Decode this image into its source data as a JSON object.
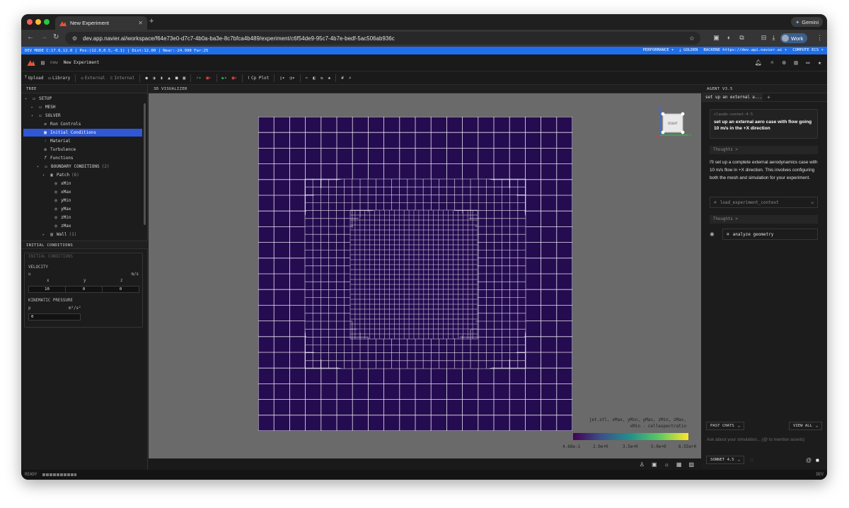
{
  "browser": {
    "tab_title": "New Experiment",
    "new_tab": "+",
    "gemini_label": "Gemini",
    "url": "dev.app.navier.ai/workspace/f64e73e0-d7c7-4b0a-ba3e-8c7bfca4b489/experiment/c6f54de9-95c7-4b7e-bedf-5ac506ab936c",
    "profile_label": "Work"
  },
  "devbar": {
    "left": "DEV MODE  C:17.6,12.0 | Pos:(12.0,0.5,-0.1) | Dist:12.00 | Near:-24.990 Far:25",
    "performance": "PERFORMANCE ▾",
    "golden": "⤓ GOLDEN",
    "backend": "BACKEND https://dev.api.navier.ai ▾",
    "compute": "COMPUTE ECS ▾"
  },
  "header": {
    "crumb_root": "new",
    "crumb_current": "New Experiment"
  },
  "toolbar": {
    "upload": "Upload",
    "library": "Library",
    "external": "External",
    "internal": "Internal",
    "cp_plot": "Cp Plot"
  },
  "tree": {
    "title": "TREE",
    "rows": [
      {
        "label": "SETUP",
        "count": ""
      },
      {
        "label": "MESH",
        "count": ""
      },
      {
        "label": "SOLVER",
        "count": ""
      },
      {
        "label": "Run Controls",
        "count": ""
      },
      {
        "label": "Initial Conditions",
        "count": ""
      },
      {
        "label": "Material",
        "count": ""
      },
      {
        "label": "Turbulence",
        "count": ""
      },
      {
        "label": "Functions",
        "count": ""
      },
      {
        "label": "BOUNDARY CONDITIONS",
        "count": "(2)"
      },
      {
        "label": "Patch",
        "count": "(6)"
      },
      {
        "label": "xMin",
        "count": ""
      },
      {
        "label": "xMax",
        "count": ""
      },
      {
        "label": "yMin",
        "count": ""
      },
      {
        "label": "yMax",
        "count": ""
      },
      {
        "label": "zMin",
        "count": ""
      },
      {
        "label": "zMax",
        "count": ""
      },
      {
        "label": "Wall",
        "count": "(1)"
      }
    ]
  },
  "initial_conditions": {
    "title": "INITIAL CONDITIONS",
    "subtitle": "INITIAL CONDITIONS",
    "velocity_label": "VELOCITY",
    "u_label": "u",
    "u_unit": "m/s",
    "x_label": "x",
    "y_label": "y",
    "z_label": "z",
    "ux": "10",
    "uy": "0",
    "uz": "0",
    "pressure_label": "KINEMATIC PRESSURE",
    "p_label": "p",
    "p_unit": "m²/s²",
    "p_value": "0"
  },
  "visualizer": {
    "title": "3D VISUALIZER",
    "cube_face": "RIGHT",
    "axis_z": "Z",
    "axis_y": "Y",
    "legend_line1": "jet.stl, xMax, yMin, yMax, zMin, zMax,",
    "legend_line2": "xMin - cellaspectratio",
    "ticks": [
      "4.68e-1",
      "2.0e+0",
      "3.5e+0",
      "5.0e+0",
      "6.55e+0"
    ],
    "colorbar_min": 0.468,
    "colorbar_max": 6.55,
    "mesh_fill": "#250c50",
    "mesh_line": "#e8e4f0"
  },
  "agent": {
    "title": "AGENT V3.5",
    "tab_label": "set up an external a...",
    "model_tag": "claude-sonnet-4-5",
    "user_message": "set up an external aero case with flow going 10 m/s in the +X direction",
    "thoughts_1": "Thoughts >",
    "reply": "I'll set up a complete external aerodynamics case with 10 m/s flow in +X direction. This involves configuring both the mesh and simulation for your experiment.",
    "tool_1": "load_experiment_context",
    "thoughts_2": "Thoughts >",
    "tool_2": "analyze geometry",
    "past_chats": "PAST CHATS",
    "view_all": "VIEW ALL",
    "input_placeholder": "Ask about your simulation... (@ to mention assets)",
    "model_select": "SONNET 4.5"
  },
  "status": {
    "left": "READY",
    "right": "DEV"
  },
  "colors": {
    "accent": "#2f57d6",
    "devbar": "#1f6feb"
  }
}
